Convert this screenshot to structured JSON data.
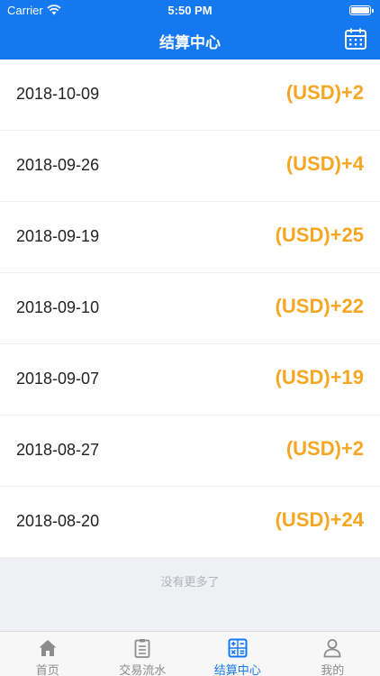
{
  "status_bar": {
    "carrier": "Carrier",
    "time": "5:50 PM"
  },
  "header": {
    "title": "结算中心",
    "action_icon": "calendar-icon"
  },
  "settlements": [
    {
      "date": "2018-10-09",
      "amount": "(USD)+2"
    },
    {
      "date": "2018-09-26",
      "amount": "(USD)+4"
    },
    {
      "date": "2018-09-19",
      "amount": "(USD)+25"
    },
    {
      "date": "2018-09-10",
      "amount": "(USD)+22"
    },
    {
      "date": "2018-09-07",
      "amount": "(USD)+19"
    },
    {
      "date": "2018-08-27",
      "amount": "(USD)+2"
    },
    {
      "date": "2018-08-20",
      "amount": "(USD)+24"
    }
  ],
  "footer": {
    "no_more_text": "没有更多了"
  },
  "tabs": [
    {
      "label": "首页",
      "icon": "home-icon",
      "active": false
    },
    {
      "label": "交易流水",
      "icon": "clipboard-icon",
      "active": false
    },
    {
      "label": "结算中心",
      "icon": "calculator-icon",
      "active": true
    },
    {
      "label": "我的",
      "icon": "person-icon",
      "active": false
    }
  ],
  "colors": {
    "primary": "#1478f0",
    "amount": "#f5a623",
    "tab_inactive": "#8c8c8c"
  }
}
